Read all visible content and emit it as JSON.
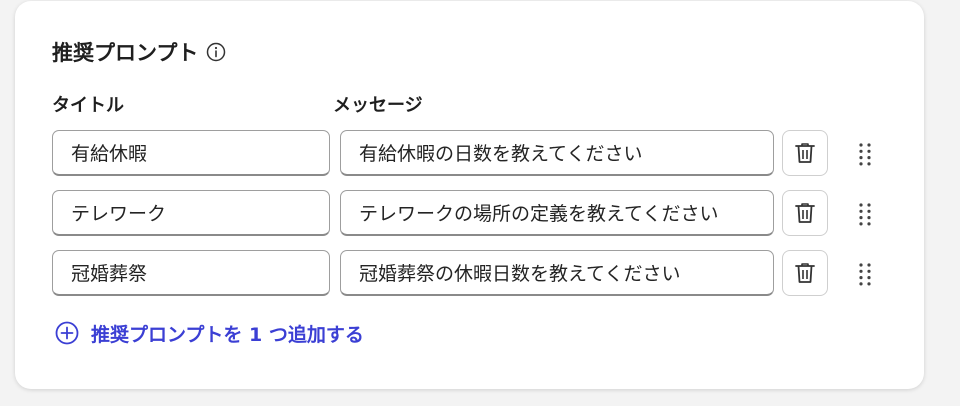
{
  "section": {
    "title": "推奨プロンプト",
    "info_icon": "info-circle-icon"
  },
  "columns": {
    "title_label": "タイトル",
    "message_label": "メッセージ"
  },
  "prompts": [
    {
      "title": "有給休暇",
      "message": "有給休暇の日数を教えてください"
    },
    {
      "title": "テレワーク",
      "message": "テレワークの場所の定義を教えてください"
    },
    {
      "title": "冠婚葬祭",
      "message": "冠婚葬祭の休暇日数を教えてください"
    }
  ],
  "actions": {
    "delete_icon": "trash-icon",
    "drag_icon": "drag-handle-icon",
    "add_label": "推奨プロンプトを 1 つ追加する",
    "add_icon": "plus-circle-icon"
  },
  "colors": {
    "accent": "#3b3fd4",
    "text": "#1f1f1f",
    "border": "#9e9e9e"
  }
}
